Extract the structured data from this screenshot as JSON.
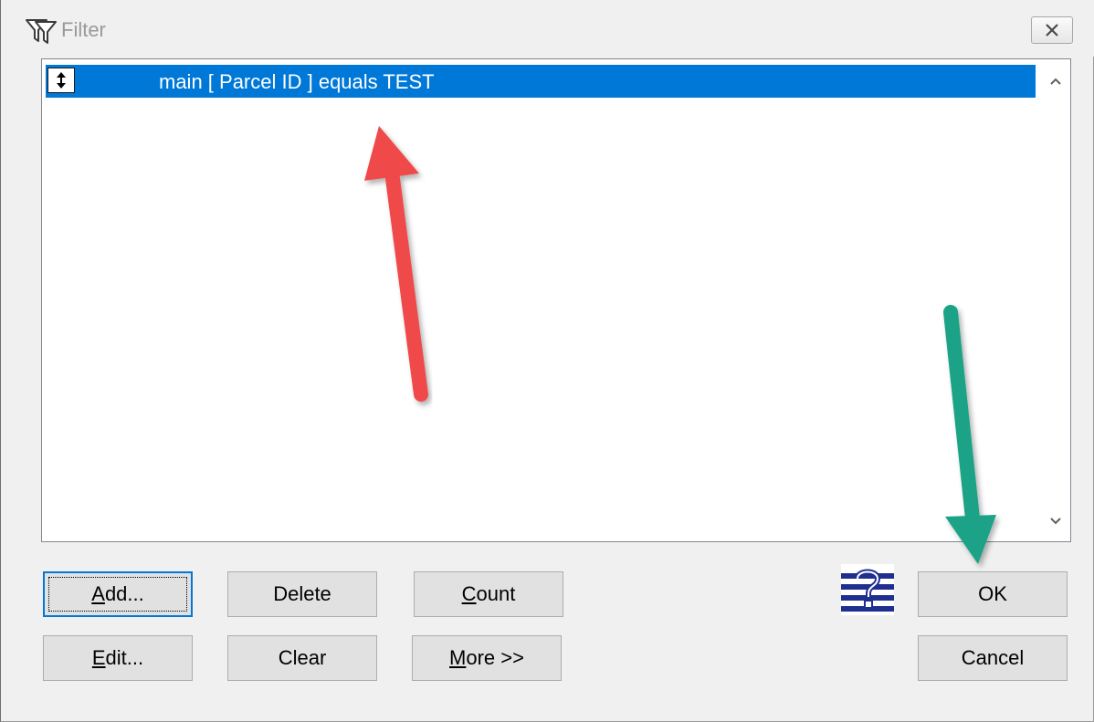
{
  "window": {
    "title": "Filter",
    "icon": "filter-funnel-icon",
    "close_icon": "close-x-icon"
  },
  "filter_list": {
    "rows": [
      {
        "toggle_icon": "up-down-toggle-icon",
        "text": "main [ Parcel ID ] equals TEST",
        "selected": true
      }
    ],
    "scroll_up_icon": "chevron-up-icon",
    "scroll_down_icon": "chevron-down-icon"
  },
  "buttons": {
    "add": {
      "mnemonic": "A",
      "rest": "dd..."
    },
    "delete": {
      "label": "Delete"
    },
    "count": {
      "mnemonic": "C",
      "rest": "ount"
    },
    "edit": {
      "mnemonic": "E",
      "rest": "dit..."
    },
    "clear": {
      "label": "Clear"
    },
    "more": {
      "mnemonic": "M",
      "rest": "ore >>"
    },
    "ok": {
      "label": "OK"
    },
    "cancel": {
      "label": "Cancel"
    },
    "help_icon": "help-question-icon"
  },
  "annotations": {
    "red_arrow_color": "#f04848",
    "green_arrow_color": "#1aa387"
  },
  "colors": {
    "selection": "#0078d7",
    "dialog_bg": "#f0f0f0",
    "button_bg": "#e1e1e1"
  }
}
